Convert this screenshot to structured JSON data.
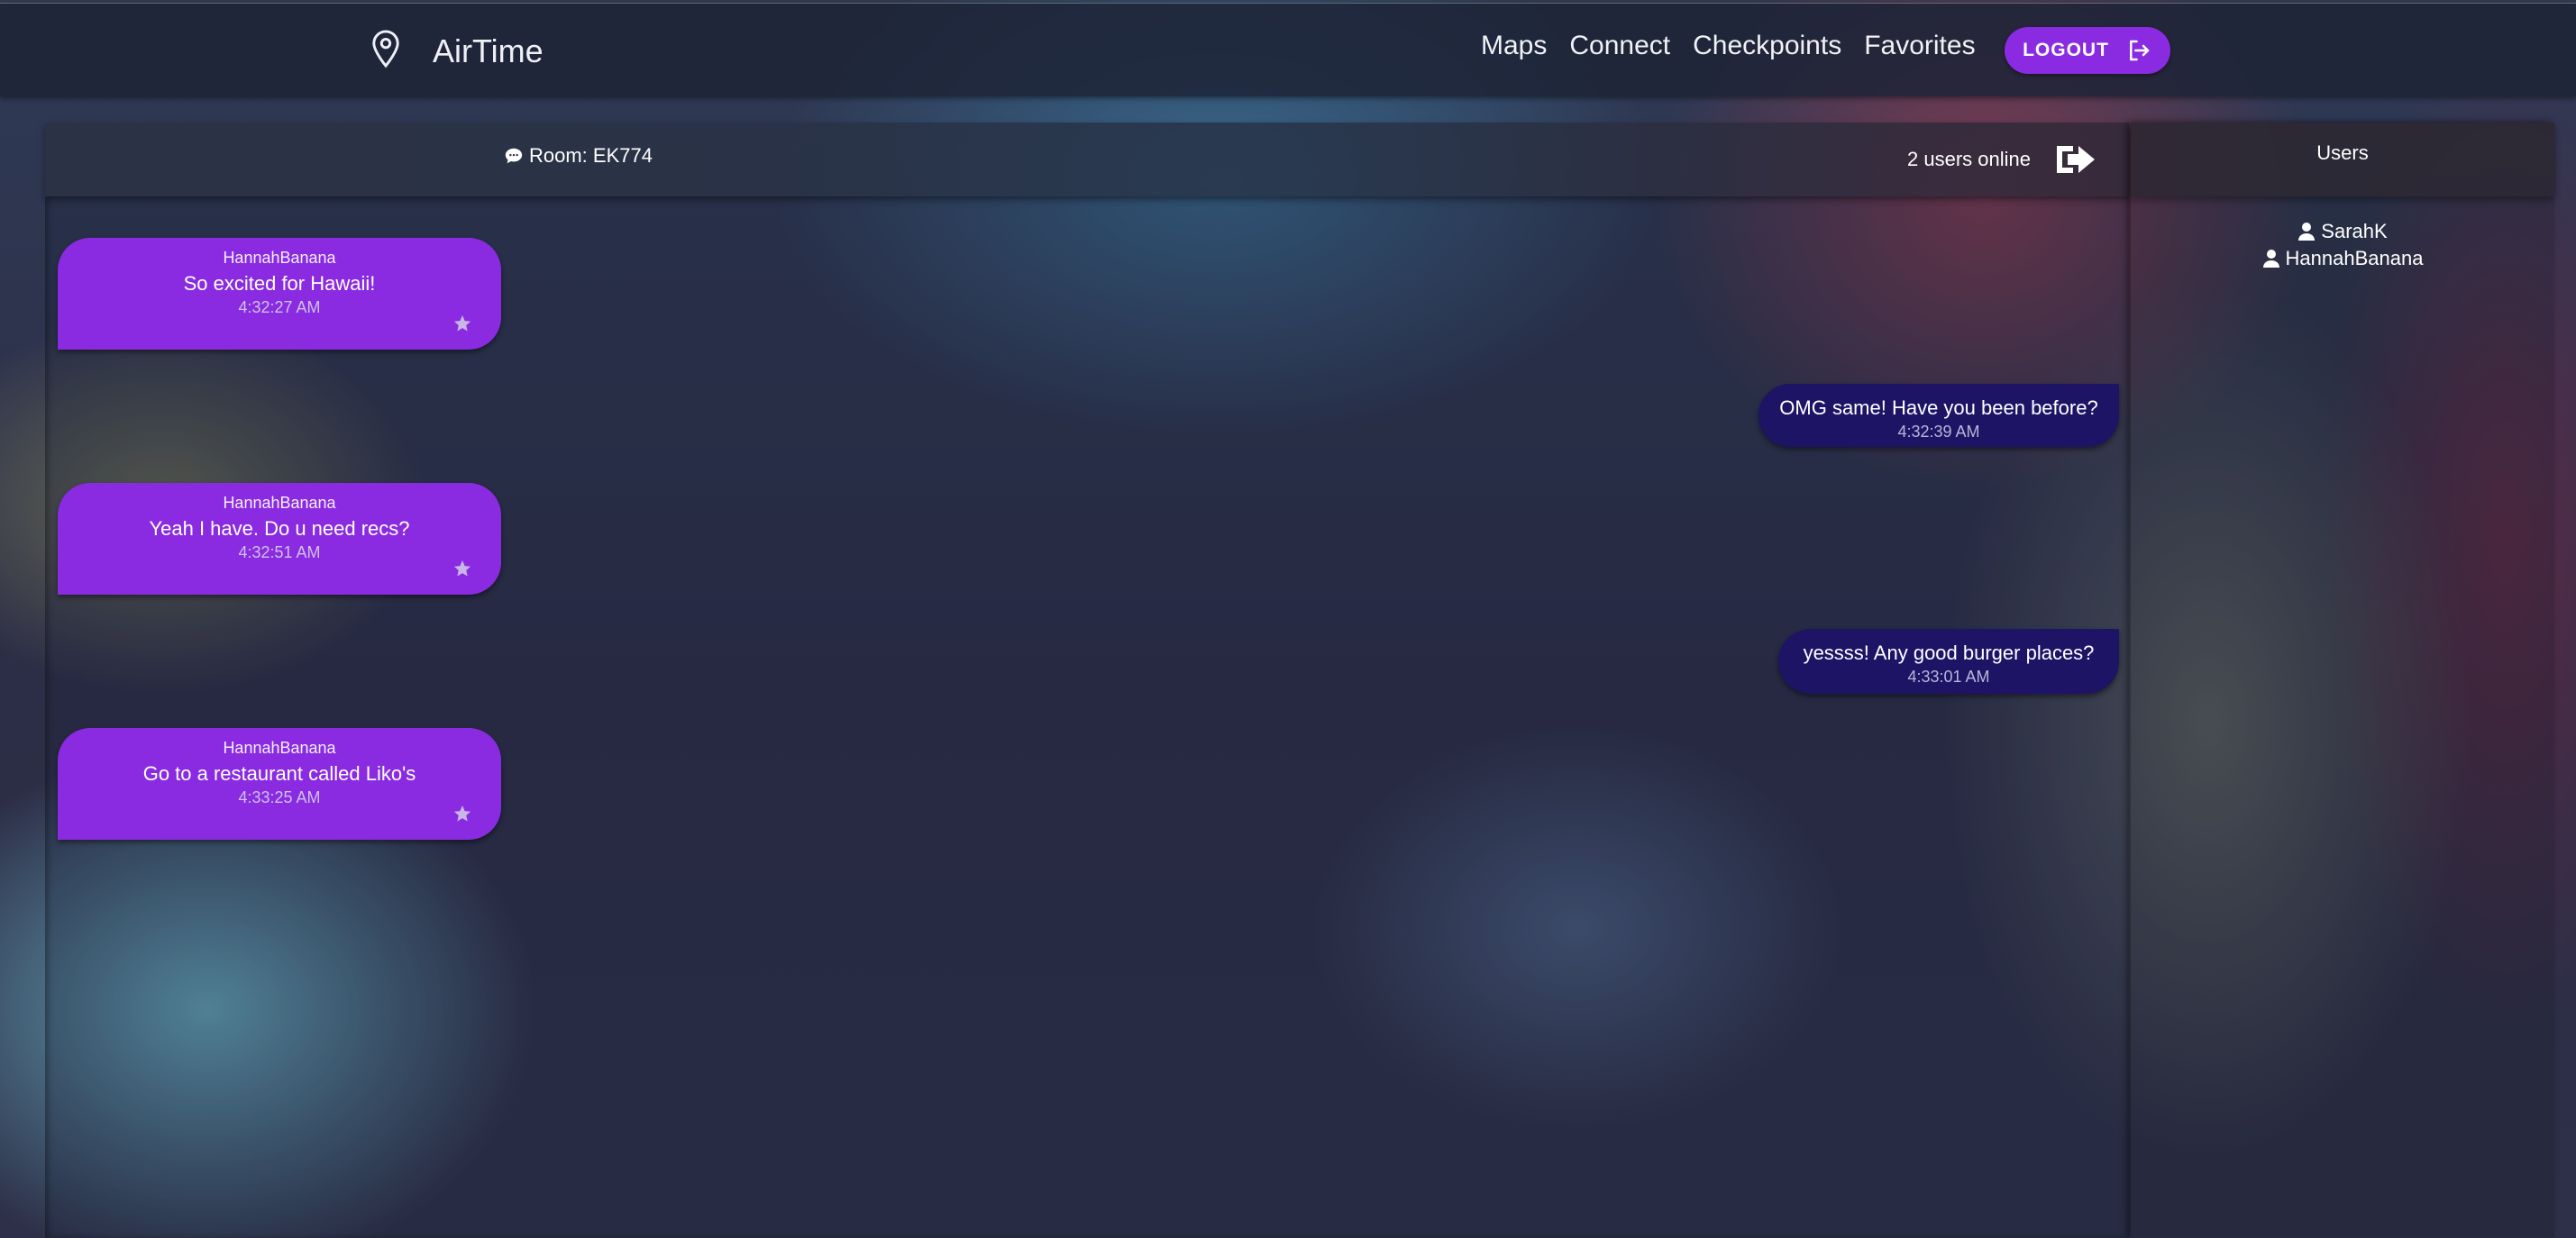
{
  "app": {
    "title": "AirTime",
    "logo_icon": "map-pin-icon"
  },
  "nav": {
    "links": [
      "Maps",
      "Connect",
      "Checkpoints",
      "Favorites"
    ],
    "logout_label": "LOGOUT"
  },
  "chat": {
    "room_label": "Room: EK774",
    "online_count": "2 users online",
    "messages": [
      {
        "type": "received",
        "user": "HannahBanana",
        "text": "So excited for Hawaii!",
        "time": "4:32:27 AM"
      },
      {
        "type": "sent",
        "text": "OMG same! Have you been before?",
        "time": "4:32:39 AM"
      },
      {
        "type": "received",
        "user": "HannahBanana",
        "text": "Yeah I have. Do u need recs?",
        "time": "4:32:51 AM"
      },
      {
        "type": "sent",
        "text": "yessss! Any good burger places?",
        "time": "4:33:01 AM"
      },
      {
        "type": "received",
        "user": "HannahBanana",
        "text": "Go to a restaurant called Liko's",
        "time": "4:33:25 AM"
      }
    ]
  },
  "users_panel": {
    "title": "Users",
    "users": [
      "SarahK",
      "HannahBanana"
    ]
  },
  "colors": {
    "accent": "#8a2be2",
    "sent_bubble": "#1d1466"
  }
}
